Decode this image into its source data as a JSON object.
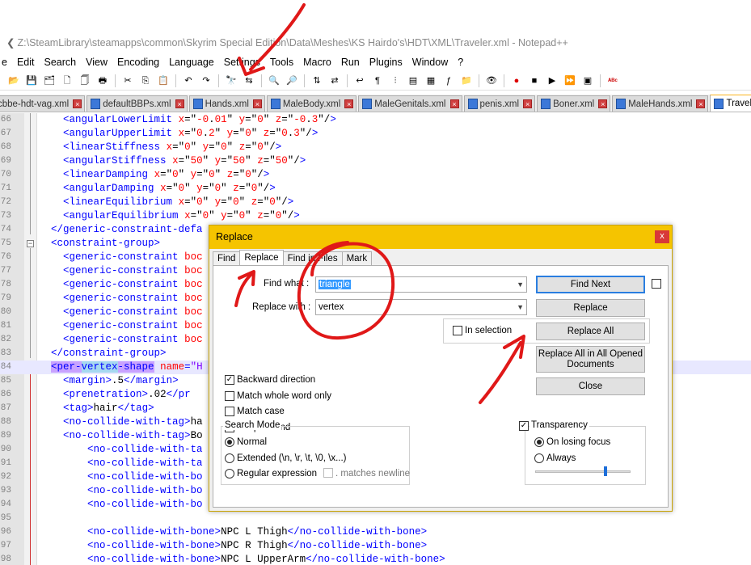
{
  "window": {
    "title": "Z:\\SteamLibrary\\steamapps\\common\\Skyrim Special Edition\\Data\\Meshes\\KS Hairdo's\\HDT\\XML\\Traveler.xml - Notepad++"
  },
  "menubar": {
    "items": [
      "e",
      "Edit",
      "Search",
      "View",
      "Encoding",
      "Language",
      "Settings",
      "Tools",
      "Macro",
      "Run",
      "Plugins",
      "Window",
      "?"
    ]
  },
  "toolbar": {
    "icons": [
      "open-icon",
      "save-icon",
      "save-all-icon",
      "close-icon",
      "close-all-icon",
      "print-icon",
      "cut-icon",
      "copy-icon",
      "paste-icon",
      "undo-icon",
      "redo-icon",
      "find-icon",
      "replace-icon",
      "zoom-in-icon",
      "zoom-out-icon",
      "sync-v-icon",
      "sync-h-icon",
      "word-wrap-icon",
      "show-all-chars-icon",
      "indent-guide-icon",
      "udl-icon",
      "doc-map-icon",
      "function-list-icon",
      "folder-icon",
      "monitor-icon",
      "record-macro-icon",
      "stop-macro-icon",
      "play-macro-icon",
      "run-macro-multiple-icon",
      "save-macro-icon",
      "spell-check-icon"
    ]
  },
  "tabs": [
    {
      "label": "cbbe-hdt-vag.xml",
      "active": false
    },
    {
      "label": "defaultBBPs.xml",
      "active": false
    },
    {
      "label": "Hands.xml",
      "active": false
    },
    {
      "label": "MaleBody.xml",
      "active": false
    },
    {
      "label": "MaleGenitals.xml",
      "active": false
    },
    {
      "label": "penis.xml",
      "active": false
    },
    {
      "label": "Boner.xml",
      "active": false
    },
    {
      "label": "MaleHands.xml",
      "active": false
    },
    {
      "label": "Traveler.xml",
      "active": true
    }
  ],
  "editor": {
    "lines": [
      {
        "num": "66",
        "text": "    <angularLowerLimit x=\"-0.01\" y=\"0\" z=\"-0.3\"/>"
      },
      {
        "num": "67",
        "text": "    <angularUpperLimit x=\"0.2\" y=\"0\" z=\"0.3\"/>"
      },
      {
        "num": "68",
        "text": "    <linearStiffness x=\"0\" y=\"0\" z=\"0\"/>"
      },
      {
        "num": "69",
        "text": "    <angularStiffness x=\"50\" y=\"50\" z=\"50\"/>"
      },
      {
        "num": "70",
        "text": "    <linearDamping x=\"0\" y=\"0\" z=\"0\"/>"
      },
      {
        "num": "71",
        "text": "    <angularDamping x=\"0\" y=\"0\" z=\"0\"/>"
      },
      {
        "num": "72",
        "text": "    <linearEquilibrium x=\"0\" y=\"0\" z=\"0\"/>"
      },
      {
        "num": "73",
        "text": "    <angularEquilibrium x=\"0\" y=\"0\" z=\"0\"/>"
      },
      {
        "num": "74",
        "text": "  </generic-constraint-defa"
      },
      {
        "num": "75",
        "text": "  <constraint-group>"
      },
      {
        "num": "76",
        "text": "    <generic-constraint boc"
      },
      {
        "num": "77",
        "text": "    <generic-constraint boc"
      },
      {
        "num": "78",
        "text": "    <generic-constraint boc"
      },
      {
        "num": "79",
        "text": "    <generic-constraint boc"
      },
      {
        "num": "80",
        "text": "    <generic-constraint boc"
      },
      {
        "num": "81",
        "text": "    <generic-constraint boc"
      },
      {
        "num": "82",
        "text": "    <generic-constraint boc"
      },
      {
        "num": "83",
        "text": "  </constraint-group>"
      },
      {
        "num": "84",
        "text": "  <per-vertex-shape name=\"H"
      },
      {
        "num": "85",
        "text": "    <margin>.5</margin>"
      },
      {
        "num": "86",
        "text": "    <prenetration>.02</pr"
      },
      {
        "num": "87",
        "text": "    <tag>hair</tag>"
      },
      {
        "num": "88",
        "text": "    <no-collide-with-tag>ha"
      },
      {
        "num": "89",
        "text": "    <no-collide-with-tag>Bo"
      },
      {
        "num": "90",
        "text": "        <no-collide-with-ta"
      },
      {
        "num": "91",
        "text": "        <no-collide-with-ta"
      },
      {
        "num": "92",
        "text": "        <no-collide-with-bo"
      },
      {
        "num": "93",
        "text": "        <no-collide-with-bo"
      },
      {
        "num": "94",
        "text": "        <no-collide-with-bo"
      },
      {
        "num": "95",
        "text": ""
      },
      {
        "num": "96",
        "text": "        <no-collide-with-bone>NPC L Thigh</no-collide-with-bone>"
      },
      {
        "num": "97",
        "text": "        <no-collide-with-bone>NPC R Thigh</no-collide-with-bone>"
      },
      {
        "num": "98",
        "text": "        <no-collide-with-bone>NPC L UpperArm</no-collide-with-bone>"
      }
    ]
  },
  "dialog": {
    "title": "Replace",
    "close_label": "x",
    "tabs": [
      "Find",
      "Replace",
      "Find in Files",
      "Mark"
    ],
    "find_what_label": "Find what :",
    "find_what_value": "triangle",
    "replace_with_label": "Replace with :",
    "replace_with_value": "vertex",
    "buttons": {
      "find_next": "Find Next",
      "replace": "Replace",
      "replace_all": "Replace All",
      "replace_all_opened": "Replace All in All Opened Documents",
      "close": "Close"
    },
    "in_selection_label": "In selection",
    "options": [
      {
        "label": "Backward direction",
        "checked": true
      },
      {
        "label": "Match whole word only",
        "checked": false
      },
      {
        "label": "Match case",
        "checked": false
      },
      {
        "label": "Wrap around",
        "checked": true
      }
    ],
    "search_mode": {
      "title": "Search Mode",
      "modes": [
        {
          "label": "Normal",
          "selected": true
        },
        {
          "label": "Extended (\\n, \\r, \\t, \\0, \\x...)",
          "selected": false
        },
        {
          "label": "Regular expression",
          "selected": false
        }
      ],
      "matches_newline_label": ". matches newline"
    },
    "transparency": {
      "label": "Transparency",
      "checked": true,
      "modes": [
        {
          "label": "On losing focus",
          "selected": true
        },
        {
          "label": "Always",
          "selected": false
        }
      ],
      "slider_level": 0.72
    }
  },
  "annotation_colors": {
    "accent": "#e01818"
  }
}
